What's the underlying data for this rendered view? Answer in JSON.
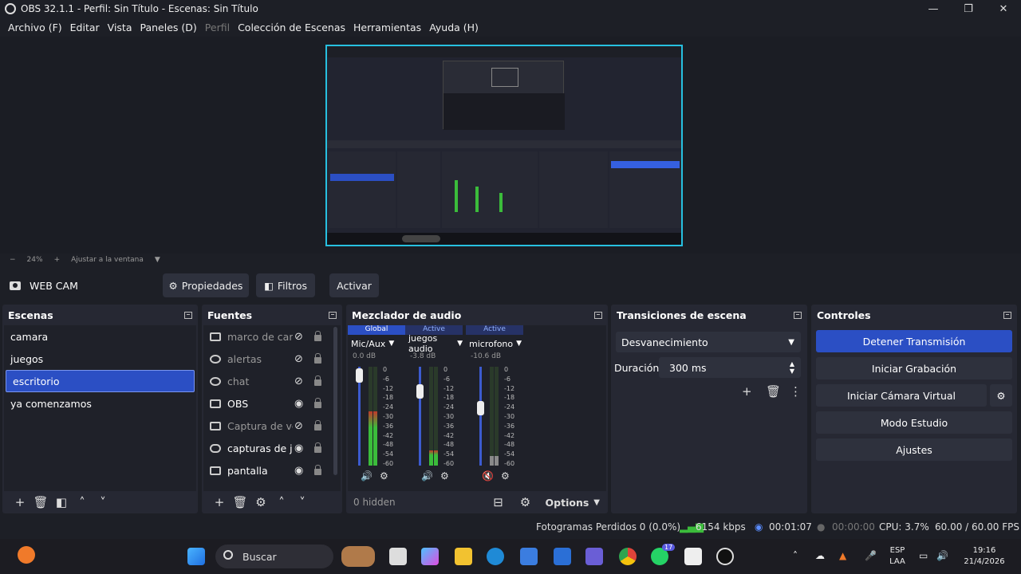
{
  "window": {
    "title": "OBS 32.1.1 - Perfil: Sin Título - Escenas: Sin Título",
    "controls": [
      "—",
      "❐",
      "✕"
    ]
  },
  "menu": {
    "items": [
      "Archivo (F)",
      "Editar",
      "Vista",
      "Paneles (D)",
      "Perfil",
      "Colección de Escenas",
      "Herramientas",
      "Ayuda (H)"
    ]
  },
  "zoom": {
    "minus": "−",
    "value": "24%",
    "plus": "+",
    "fit_label": "Ajustar a la ventana"
  },
  "source_bar": {
    "source_name": "WEB CAM",
    "properties_label": "Propiedades",
    "filters_label": "Filtros",
    "activate_label": "Activar"
  },
  "scenes": {
    "title": "Escenas",
    "items": [
      "camara",
      "juegos",
      "escritorio",
      "ya comenzamos"
    ],
    "selected": "escritorio"
  },
  "sources": {
    "title": "Fuentes",
    "items": [
      {
        "name": "marco de cam",
        "visible": false
      },
      {
        "name": "alertas",
        "visible": false
      },
      {
        "name": "chat",
        "visible": false
      },
      {
        "name": "OBS",
        "visible": true
      },
      {
        "name": "Captura de ve",
        "visible": false
      },
      {
        "name": "capturas de ju",
        "visible": true
      },
      {
        "name": "pantalla",
        "visible": true
      }
    ]
  },
  "mixer": {
    "title": "Mezclador de audio",
    "channels": [
      {
        "tag": "Global",
        "name": "Mic/Aux",
        "db": "0.0 dB",
        "fader": 0.98,
        "level": 0.55
      },
      {
        "tag": "Active",
        "name": "juegos audio",
        "db": "-3.8 dB",
        "fader": 0.82,
        "level": 0.15
      },
      {
        "tag": "Active",
        "name": "microfono",
        "db": "-10.6 dB",
        "fader": 0.65,
        "level": 0.1
      }
    ],
    "scale": [
      "0",
      "-6",
      "-12",
      "-18",
      "-24",
      "-30",
      "-36",
      "-42",
      "-48",
      "-54",
      "-60"
    ],
    "hidden_label": "0 hidden",
    "options_label": "Options"
  },
  "transitions": {
    "title": "Transiciones de escena",
    "selected": "Desvanecimiento",
    "duration_label": "Duración",
    "duration_value": "300 ms"
  },
  "controls": {
    "title": "Controles",
    "buttons": [
      "Detener Transmisión",
      "Iniciar Grabación",
      "Iniciar Cámara Virtual",
      "Modo Estudio",
      "Ajustes"
    ]
  },
  "status": {
    "dropped": "Fotogramas Perdidos 0 (0.0%)",
    "bitrate": "6154 kbps",
    "stream_time": "00:01:07",
    "rec_time": "00:00:00",
    "cpu": "CPU: 3.7%",
    "fps": "60.00 / 60.00 FPS"
  },
  "taskbar": {
    "search_label": "Buscar",
    "whatsapp_badge": "17",
    "lang_top": "ESP",
    "lang_bottom": "LAA",
    "time": "19:16",
    "date": "21/4/2026"
  },
  "colors": {
    "accent": "#2b4fc4",
    "preview_border": "#27c0e0",
    "meter_green": "#3bbc3b",
    "meter_red": "#c0392b"
  }
}
